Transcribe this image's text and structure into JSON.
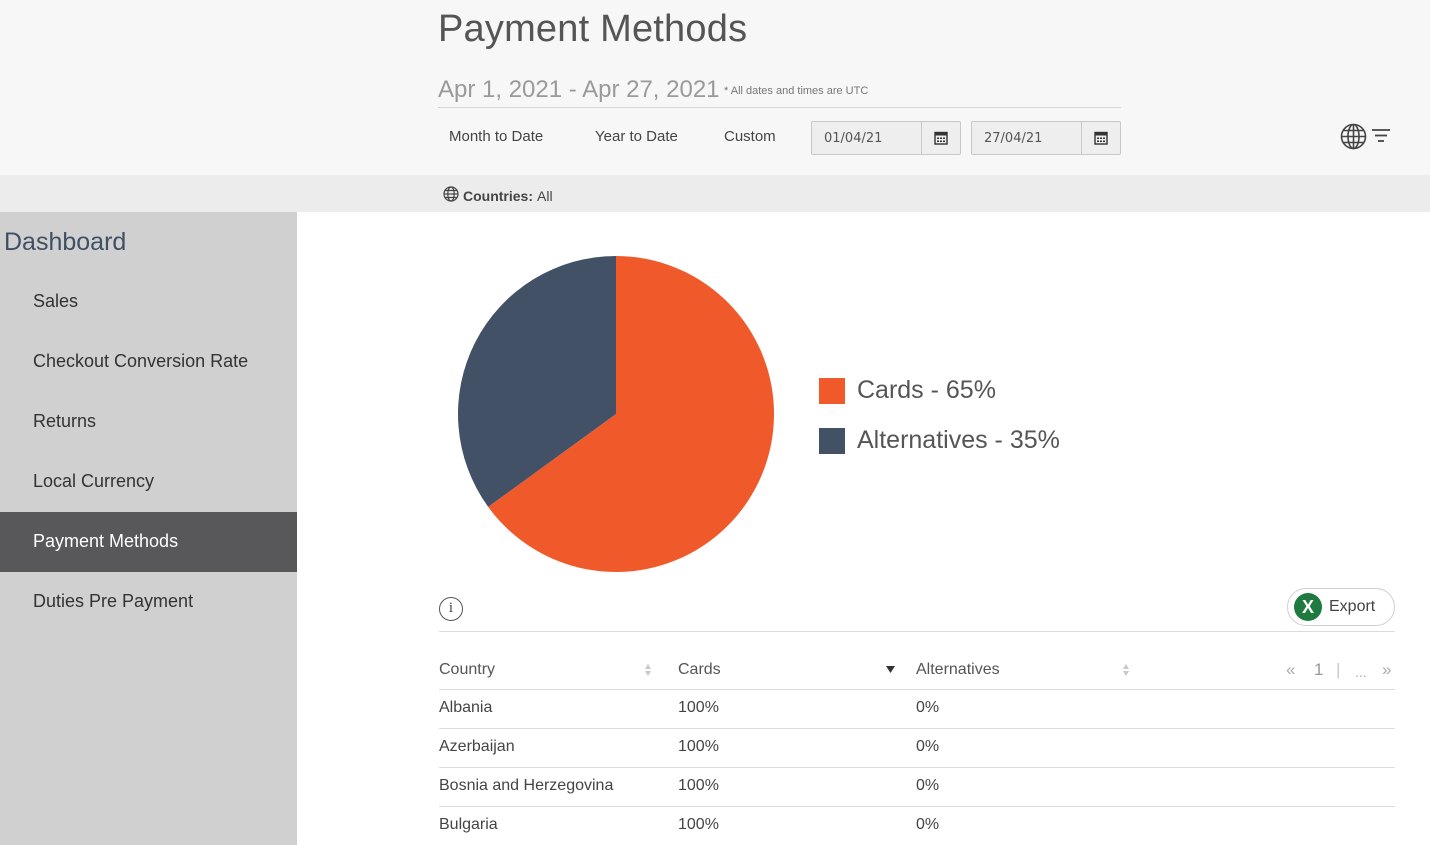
{
  "header": {
    "title": "Payment Methods",
    "date_range": "Apr 1, 2021 - Apr 27, 2021",
    "utc_note": "* All dates and times are UTC",
    "range_buttons": [
      "Month to Date",
      "Year to Date",
      "Custom"
    ],
    "start_date": "01/04/21",
    "end_date": "27/04/21"
  },
  "filter_bar": {
    "countries_label": "Countries:",
    "countries_value": "All"
  },
  "sidebar": {
    "title": "Dashboard",
    "items": [
      {
        "label": "Sales",
        "active": false
      },
      {
        "label": "Checkout Conversion Rate",
        "active": false
      },
      {
        "label": "Returns",
        "active": false
      },
      {
        "label": "Local Currency",
        "active": false
      },
      {
        "label": "Payment Methods",
        "active": true
      },
      {
        "label": "Duties Pre Payment",
        "active": false
      }
    ]
  },
  "chart_data": {
    "type": "pie",
    "slices": [
      {
        "label": "Cards - 65%",
        "value": 65,
        "color": "#f05a2b"
      },
      {
        "label": "Alternatives - 35%",
        "value": 35,
        "color": "#435166"
      }
    ]
  },
  "table": {
    "info_icon": "i",
    "export_label": "Export",
    "export_icon": "X",
    "columns": [
      "Country",
      "Cards",
      "Alternatives"
    ],
    "pager": {
      "first": "«",
      "page": "1",
      "sep": "|",
      "ellipsis": "...",
      "last": "»"
    },
    "rows": [
      [
        "Albania",
        "100%",
        "0%"
      ],
      [
        "Azerbaijan",
        "100%",
        "0%"
      ],
      [
        "Bosnia and Herzegovina",
        "100%",
        "0%"
      ],
      [
        "Bulgaria",
        "100%",
        "0%"
      ]
    ]
  },
  "colors": {
    "accent": "#f05a2b",
    "navy": "#435166",
    "sidebar_bg": "#d0d0d0",
    "sidebar_active": "#58585a"
  }
}
